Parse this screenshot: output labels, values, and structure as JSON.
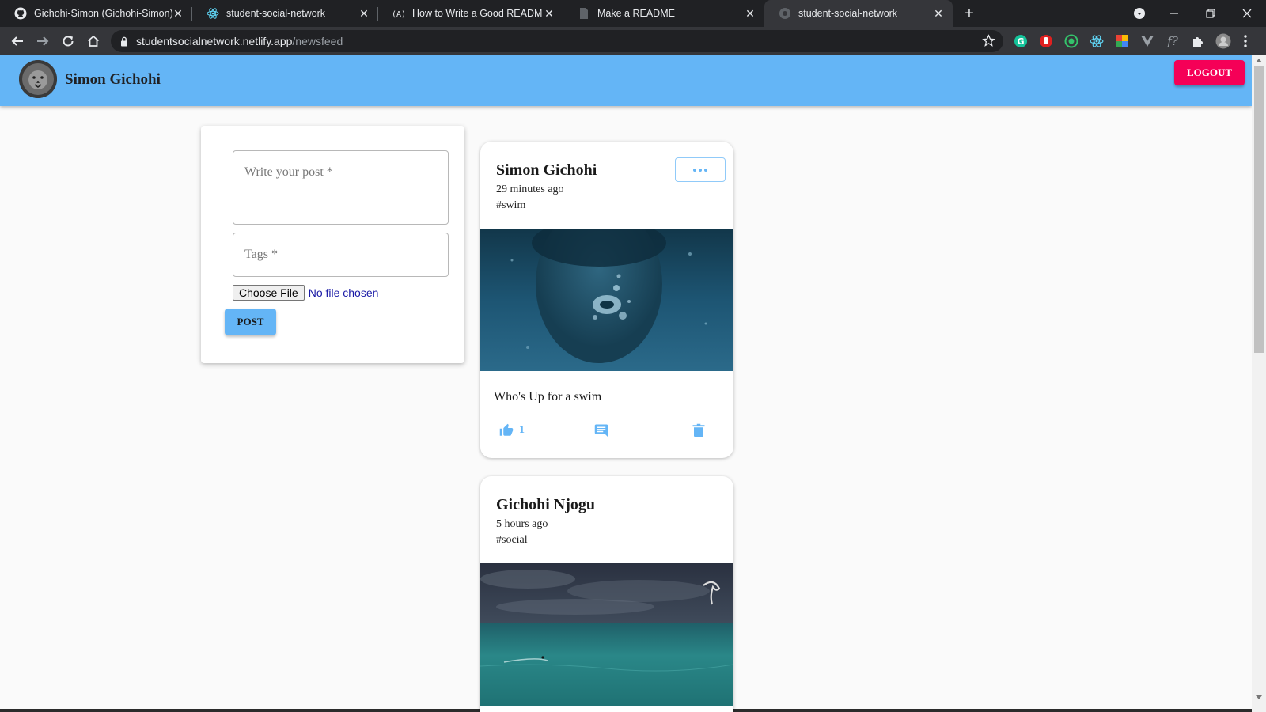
{
  "browser": {
    "tabs": [
      {
        "title": "Gichohi-Simon (Gichohi-Simon)",
        "icon": "github-icon"
      },
      {
        "title": "student-social-network",
        "icon": "react-icon"
      },
      {
        "title": "How to Write a Good README Fi",
        "icon": "freecodecamp-icon"
      },
      {
        "title": "Make a README",
        "icon": "document-icon"
      },
      {
        "title": "student-social-network",
        "icon": "globe-icon",
        "active": true
      }
    ],
    "url_host": "studentsocialnetwork.netlify.app",
    "url_path": "/newsfeed"
  },
  "header": {
    "user_name": "Simon Gichohi",
    "logout_label": "LOGOUT"
  },
  "post_form": {
    "post_placeholder": "Write your post *",
    "tags_placeholder": "Tags *",
    "choose_file_label": "Choose File",
    "no_file_text": "No file chosen",
    "post_button": "POST"
  },
  "feed": [
    {
      "author": "Simon Gichohi",
      "time": "29 minutes ago",
      "tag": "#swim",
      "text": "Who's Up for a swim",
      "likes": "1",
      "image": "underwater-swimmer-photo"
    },
    {
      "author": "Gichohi Njogu",
      "time": "5 hours ago",
      "tag": "#social",
      "image": "kitesurfing-ocean-photo"
    }
  ],
  "colors": {
    "appbar": "#64b5f6",
    "logout": "#f50057",
    "accent": "#64b5f6"
  }
}
